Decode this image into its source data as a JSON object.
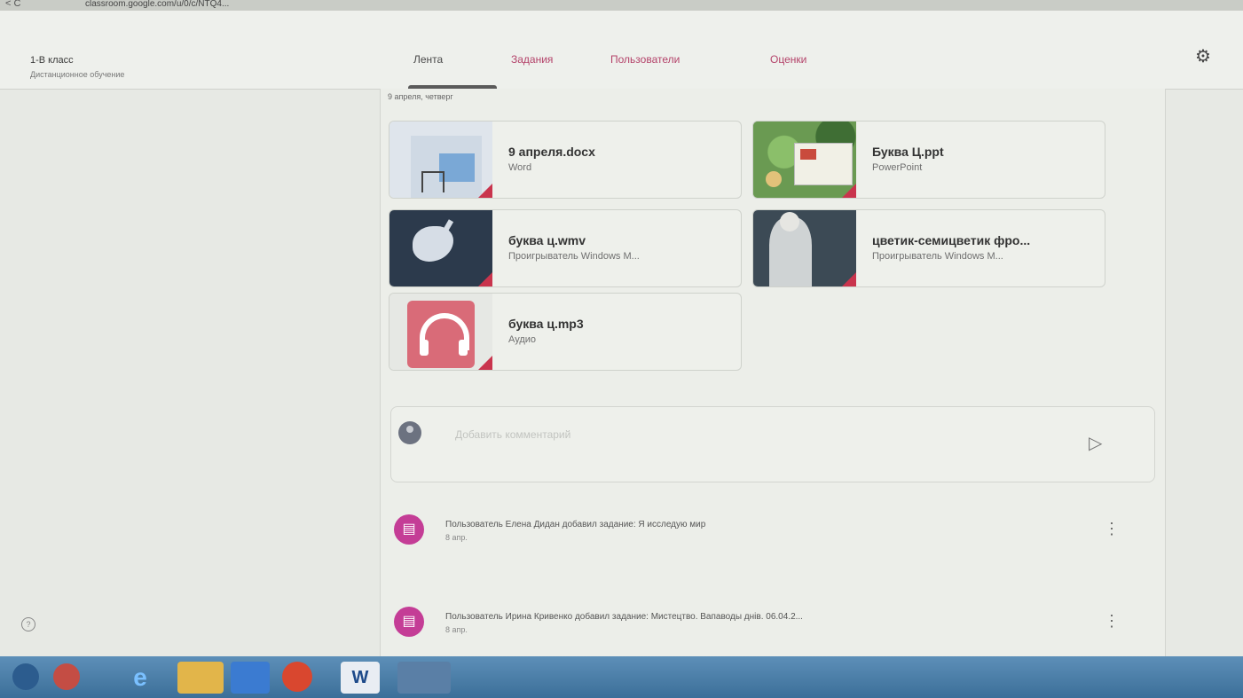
{
  "browser": {
    "nav": "< C",
    "url": "classroom.google.com/u/0/c/NTQ4..."
  },
  "course": {
    "title": "1-В класс",
    "subtitle": "Дистанционное обучение"
  },
  "tabs": [
    {
      "label": "Лента",
      "active": true
    },
    {
      "label": "Задания",
      "active": false
    },
    {
      "label": "Пользователи",
      "active": false
    },
    {
      "label": "Оценки",
      "active": false
    }
  ],
  "post": {
    "date": "9 апреля, четверг"
  },
  "attachments": [
    {
      "name": "9 апреля.docx",
      "type": "Word",
      "thumb": "doc"
    },
    {
      "name": "Буква Ц.ppt",
      "type": "PowerPoint",
      "thumb": "ppt"
    },
    {
      "name": "буква ц.wmv",
      "type": "Проигрыватель Windows M...",
      "thumb": "bird"
    },
    {
      "name": "цветик-семицветик фро...",
      "type": "Проигрыватель Windows M...",
      "thumb": "fairy"
    },
    {
      "name": "буква ц.mp3",
      "type": "Аудио",
      "thumb": "audio"
    }
  ],
  "comment": {
    "placeholder": "Добавить комментарий",
    "send_icon": "send-icon"
  },
  "activity": [
    {
      "text": "Пользователь Елена Дидан добавил задание: Я исследую мир",
      "time": "8 апр."
    },
    {
      "text": "Пользователь Ирина Кривенко добавил задание: Мистецтво. Вапаводы днiв. 06.04.2...",
      "time": "8 апр."
    }
  ],
  "colors": {
    "accent": "#b4436a",
    "assignment_icon": "#c43d96",
    "file_corner": "#c9344d"
  },
  "taskbar": {
    "word_label": "W",
    "ie_label": "e"
  }
}
